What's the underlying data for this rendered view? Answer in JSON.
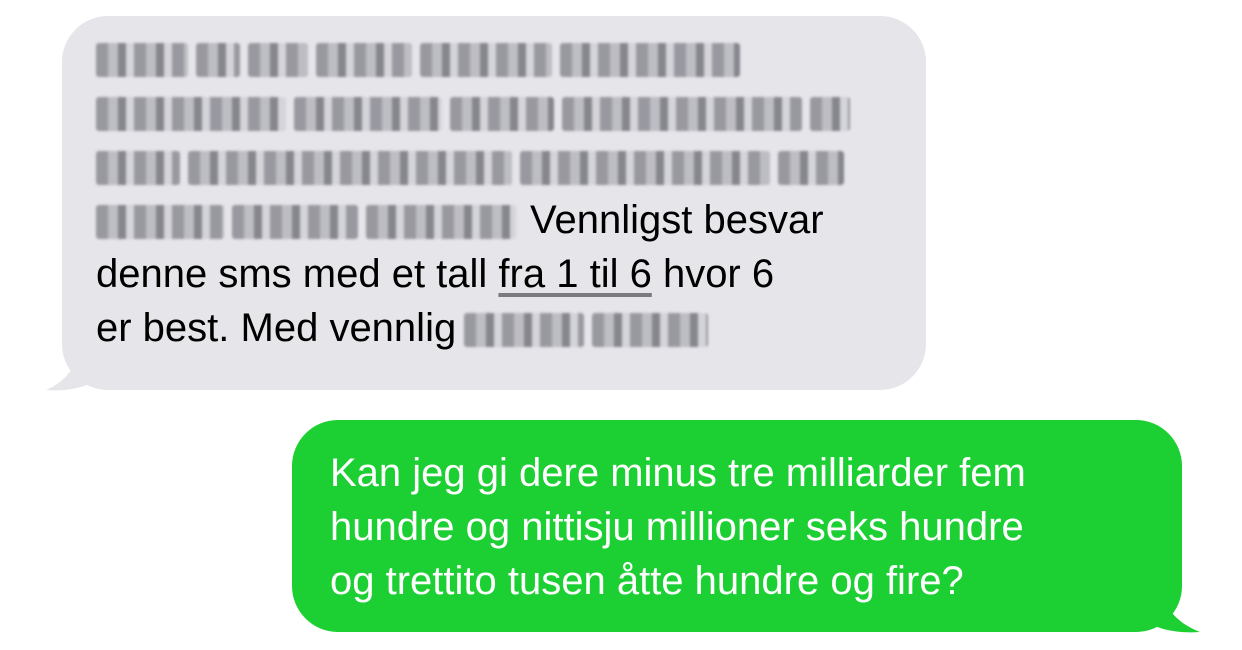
{
  "conversation": {
    "incoming": {
      "visible_text_start": "Vennligst besvar",
      "line_2_before_link": "denne sms med et tall ",
      "link_text": "fra 1 til 6",
      "line_2_after_link": " hvor 6",
      "line_3": "er best. Med vennlig",
      "bubble_color": "#e5e5ea",
      "text_color": "#000000"
    },
    "outgoing": {
      "line_1": "Kan jeg gi dere minus tre milliarder fem",
      "line_2": "hundre og nittisju millioner seks hundre",
      "line_3": "og trettito tusen åtte hundre og fire?",
      "bubble_color": "#1ccf32",
      "text_color": "#ffffff"
    }
  }
}
